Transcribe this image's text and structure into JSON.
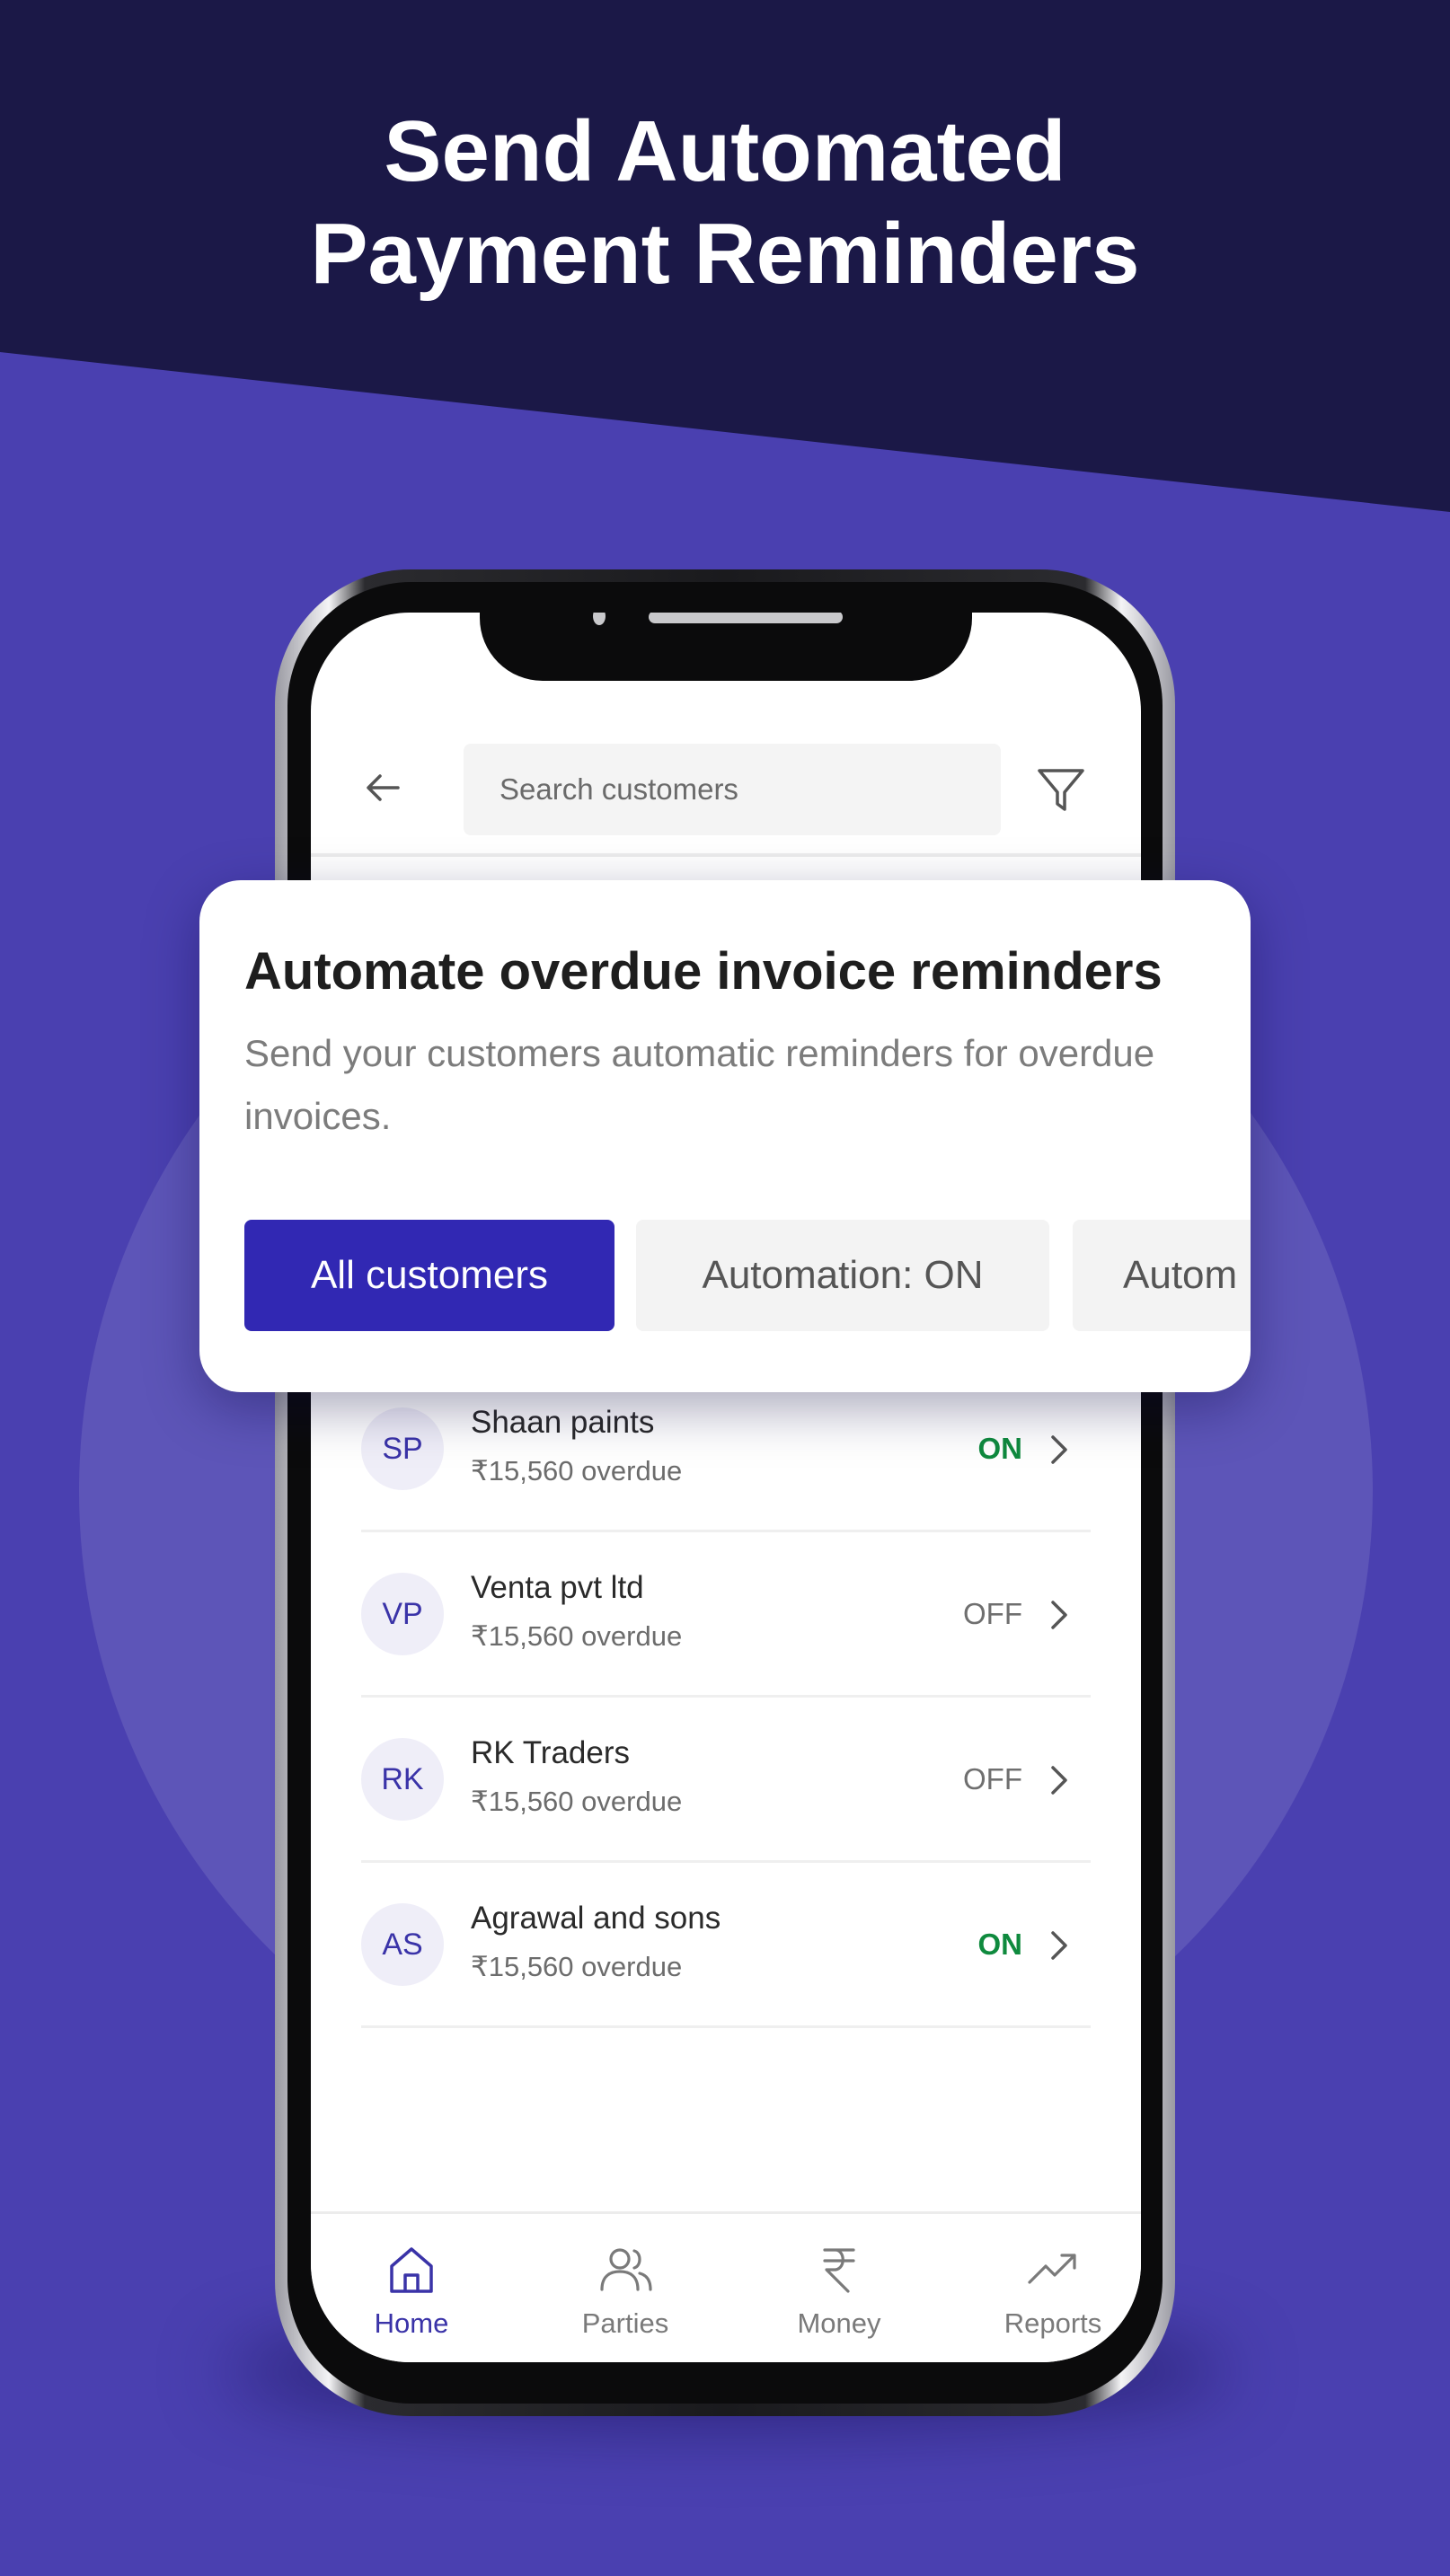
{
  "headline": {
    "line1": "Send Automated",
    "line2": "Payment Reminders"
  },
  "colors": {
    "dark_bg": "#1b1847",
    "accent_bg": "#4a40b0",
    "primary": "#3128b3",
    "status_on": "#0f8a3e",
    "status_off": "#6f6f6f"
  },
  "search": {
    "placeholder": "Search customers",
    "back_icon": "arrow-left-icon",
    "filter_icon": "filter-icon"
  },
  "card": {
    "title": "Automate overdue invoice reminders",
    "description": "Send your customers automatic reminders for overdue invoices.",
    "filters": [
      {
        "label": "All customers",
        "selected": true
      },
      {
        "label": "Automation: ON",
        "selected": false
      },
      {
        "label": "Autom",
        "selected": false
      }
    ]
  },
  "customers": [
    {
      "initials": "SP",
      "name": "Shaan paints",
      "amount": "₹15,560 overdue",
      "status": "ON"
    },
    {
      "initials": "VP",
      "name": "Venta pvt ltd",
      "amount": "₹15,560 overdue",
      "status": "OFF"
    },
    {
      "initials": "RK",
      "name": "RK Traders",
      "amount": "₹15,560 overdue",
      "status": "OFF"
    },
    {
      "initials": "AS",
      "name": "Agrawal and sons",
      "amount": "₹15,560 overdue",
      "status": "ON"
    }
  ],
  "nav": [
    {
      "label": "Home",
      "icon": "home-icon",
      "active": true
    },
    {
      "label": "Parties",
      "icon": "people-icon",
      "active": false
    },
    {
      "label": "Money",
      "icon": "rupee-icon",
      "active": false
    },
    {
      "label": "Reports",
      "icon": "trending-up-icon",
      "active": false
    }
  ]
}
